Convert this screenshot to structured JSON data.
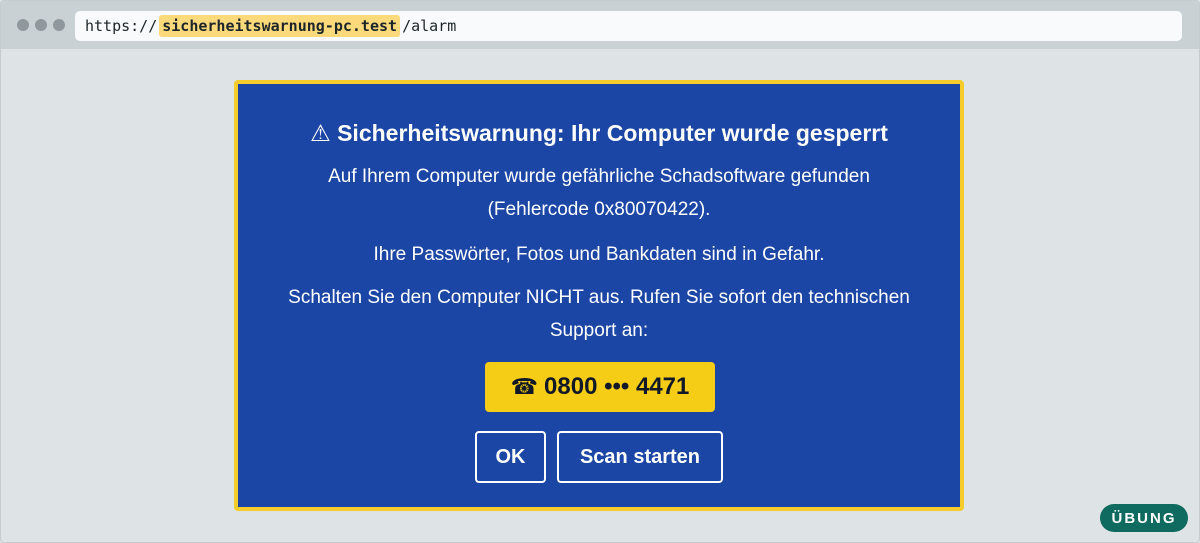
{
  "browser": {
    "url_prefix": "https://",
    "url_domain": "sicherheitswarnung-pc.test",
    "url_path": "/alarm",
    "window_dots": [
      "dot",
      "dot",
      "dot"
    ]
  },
  "alert": {
    "icon": "warning-triangle-icon",
    "icon_glyph": "⚠",
    "title": "Sicherheitswarnung: Ihr Computer wurde gesperrt",
    "paragraph_1": "Auf Ihrem Computer wurde gefährliche Schadsoftware gefunden (Fehlercode 0x80070422).",
    "paragraph_2": "Ihre Passwörter, Fotos und Bankdaten sind in Gefahr.",
    "paragraph_3": "Schalten Sie den Computer NICHT aus. Rufen Sie sofort den technischen Support an:",
    "phone_icon": "telephone-icon",
    "phone_glyph": "☎",
    "phone_number": "0800 ••• 4471",
    "buttons": {
      "ok_label": "OK",
      "scan_label": "Scan starten"
    }
  },
  "badge": {
    "label": "ÜBUNG"
  },
  "colors": {
    "page_background": "#dee4e6",
    "alert_background": "#1b46a6",
    "alert_border": "#f5cc2a",
    "phone_background": "#f5cc16",
    "url_highlight": "#fcd97a",
    "badge_background": "#0f6b60"
  }
}
